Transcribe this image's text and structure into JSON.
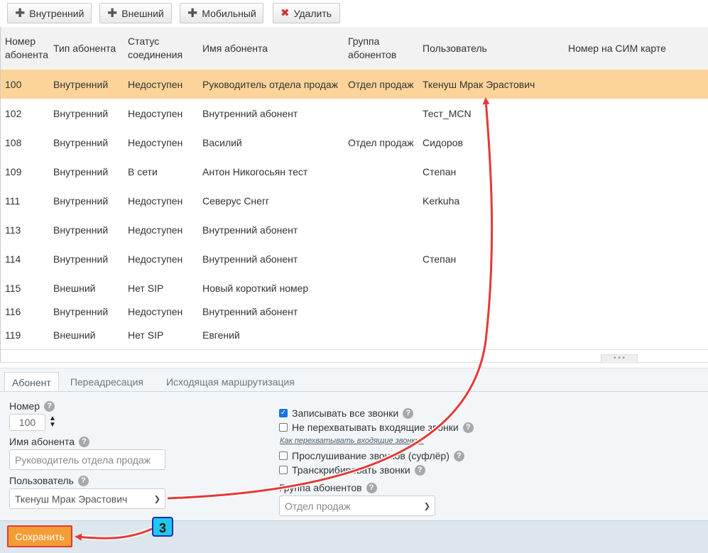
{
  "toolbar": {
    "add_internal": "Внутренний",
    "add_external": "Внешний",
    "add_mobile": "Мобильный",
    "delete": "Удалить"
  },
  "table": {
    "headers": [
      "Номер абонента",
      "Тип абонента",
      "Статус соединения",
      "Имя абонента",
      "Группа абонентов",
      "Пользователь",
      "Номер на СИМ карте"
    ],
    "rows": [
      [
        "100",
        "Внутренний",
        "Недоступен",
        "Руководитель отдела продаж",
        "Отдел продаж",
        "Ткенуш Мрак Эрастович",
        ""
      ],
      [
        "102",
        "Внутренний",
        "Недоступен",
        "Внутренний абонент",
        "",
        "Тест_MCN",
        ""
      ],
      [
        "108",
        "Внутренний",
        "Недоступен",
        "Василий",
        "Отдел продаж",
        "Сидоров",
        ""
      ],
      [
        "109",
        "Внутренний",
        "В сети",
        "Антон Никогосьян тест",
        "",
        "Степан",
        ""
      ],
      [
        "111",
        "Внутренний",
        "Недоступен",
        "Северус Снегг",
        "",
        "Kerkuha",
        ""
      ],
      [
        "113",
        "Внутренний",
        "Недоступен",
        "Внутренний абонент",
        "",
        "",
        ""
      ],
      [
        "114",
        "Внутренний",
        "Недоступен",
        "Внутренний абонент",
        "",
        "Степан",
        ""
      ],
      [
        "115",
        "Внешний",
        "Нет SIP",
        "Новый короткий номер",
        "",
        "",
        ""
      ],
      [
        "116",
        "Внутренний",
        "Недоступен",
        "Внутренний абонент",
        "",
        "",
        ""
      ],
      [
        "119",
        "Внешний",
        "Нет SIP",
        "Евгений",
        "",
        "",
        ""
      ]
    ]
  },
  "tabs": [
    "Абонент",
    "Переадресация",
    "Исходящая маршрутизация"
  ],
  "form": {
    "number_label": "Номер",
    "number_value": "100",
    "name_label": "Имя абонента",
    "name_value": "Руководитель отдела продаж",
    "user_label": "Пользователь",
    "user_value": "Ткенуш Мрак Эрастович",
    "record_all": "Записывать все звонки",
    "no_intercept": "Не перехватывать входящие звонки",
    "intercept_link": "Как перехватывать входящие звонки?",
    "listen": "Прослушивание звонков (суфлёр)",
    "transcribe": "Транскрибировать звонки",
    "group_label": "Группа абонентов",
    "group_value": "Отдел продаж",
    "help": "?"
  },
  "footer": {
    "save": "Сохранить"
  },
  "annotation": {
    "step": "3"
  },
  "colors": {
    "selected_row": "#fcd49a",
    "save_button": "#f49c36",
    "arrow": "#e53935",
    "badge": "#1fc8f0"
  }
}
